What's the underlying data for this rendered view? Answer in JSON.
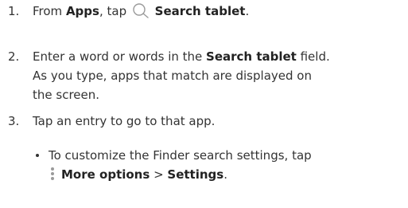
{
  "steps": [
    {
      "number": "1.",
      "parts": {
        "t1": "From ",
        "b1": "Apps",
        "t2": ", tap ",
        "icon": "search-icon",
        "b2": "Search tablet",
        "t3": "."
      }
    },
    {
      "number": "2.",
      "parts": {
        "t1": "Enter a word or words in the ",
        "b1": "Search tablet",
        "t2": " field.",
        "line2": "As you type, apps that match are displayed on",
        "line3": "the screen."
      }
    },
    {
      "number": "3.",
      "parts": {
        "t1": "Tap an entry to go to that app."
      }
    }
  ],
  "bullet": {
    "line1": "To customize the Finder search settings, tap",
    "icon": "more-options-icon",
    "b1": "More options",
    "sep": " > ",
    "b2": "Settings",
    "end": "."
  },
  "colors": {
    "text": "#333333",
    "icon": "#9a9a9a"
  }
}
